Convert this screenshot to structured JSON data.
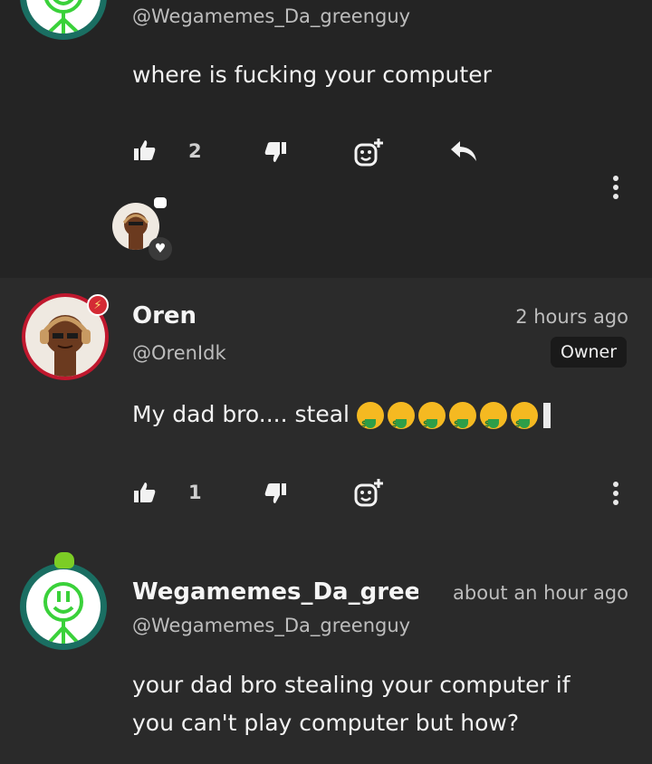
{
  "comments": [
    {
      "handle": "@Wegamemes_Da_greenguy",
      "text": "where is fucking your computer",
      "likes": "2"
    },
    {
      "name": "Oren",
      "handle": "@OrenIdk",
      "time": "2 hours ago",
      "badge": "Owner",
      "text": "My dad bro.... steal",
      "likes": "1"
    },
    {
      "name": "Wegamemes_Da_gree",
      "handle": "@Wegamemes_Da_greenguy",
      "time": "about an hour ago",
      "text_line1": "your dad bro stealing your computer if",
      "text_line2": "you can't play computer but how?"
    }
  ],
  "icons": {
    "like": "thumbs-up-icon",
    "dislike": "thumbs-down-icon",
    "react": "add-reaction-icon",
    "reply": "reply-icon",
    "more": "more-options-icon",
    "heart": "heart-icon",
    "money_emoji": "money-mouth-face-emoji"
  },
  "colors": {
    "background": "#2b2b2b",
    "green_ring": "#1a6e62",
    "owner_ring": "#c0182e",
    "accent_green": "#3ad13a"
  }
}
